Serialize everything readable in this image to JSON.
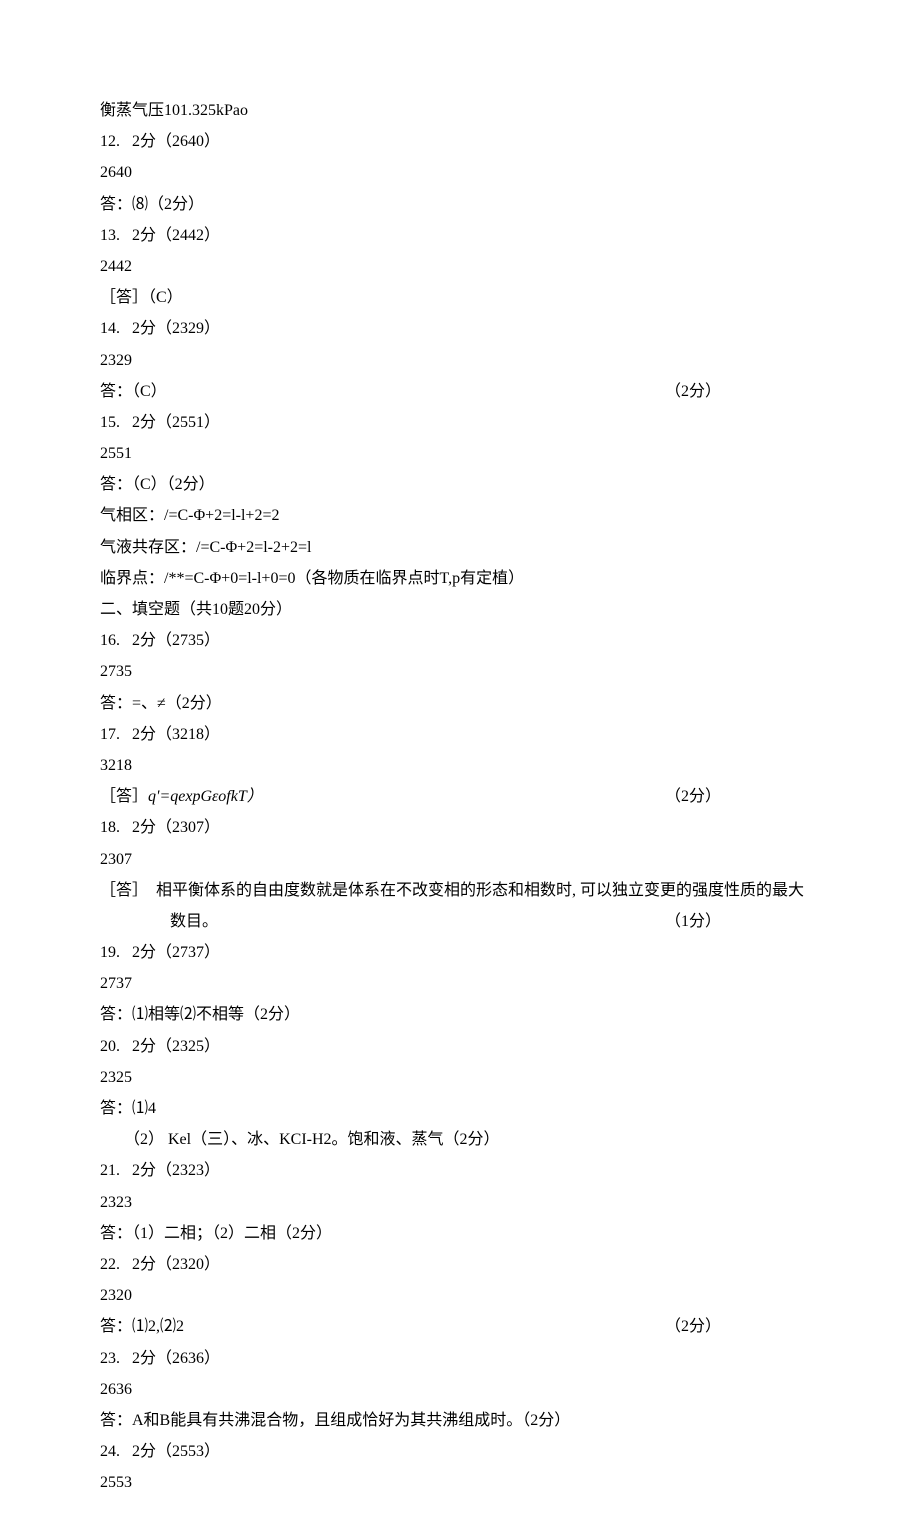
{
  "lines": [
    {
      "text": "衡蒸气压101.325kPao"
    },
    {
      "text": "12.   2分（2640）"
    },
    {
      "text": "2640"
    },
    {
      "text": "答：⑻（2分）"
    },
    {
      "text": "13.   2分（2442）"
    },
    {
      "text": "2442"
    },
    {
      "text": "［答］（C）"
    },
    {
      "text": "14.   2分（2329）"
    },
    {
      "text": "2329"
    },
    {
      "text": "答：（C）",
      "right": "（2分）"
    },
    {
      "text": "15.   2分（2551）"
    },
    {
      "text": "2551"
    },
    {
      "text": "答：（C）（2分）"
    },
    {
      "text": "气相区：/=C-Φ+2=l-l+2=2"
    },
    {
      "text": "气液共存区：/=C-Φ+2=l-2+2=l"
    },
    {
      "text": "临界点：/**=C-Φ+0=l-l+0=0（各物质在临界点时T,p有定植）"
    },
    {
      "text": "二、填空题（共10题20分）"
    },
    {
      "text": "16.   2分（2735）"
    },
    {
      "text": "2735"
    },
    {
      "text": "答：=、≠（2分）"
    },
    {
      "text": "17.   2分（3218）"
    },
    {
      "text": "3218"
    },
    {
      "text": "［答］",
      "italicTail": "q'=qexpGεofkT）",
      "right": "（2分）"
    },
    {
      "text": "18.   2分（2307）"
    },
    {
      "text": "2307"
    },
    {
      "text": "［答］  相平衡体系的自由度数就是体系在不改变相的形态和相数时, 可以独立变更的强度性质的最大"
    },
    {
      "text": "数目。",
      "indent": "big",
      "right": "（1分）"
    },
    {
      "text": "19.   2分（2737）"
    },
    {
      "text": "2737"
    },
    {
      "text": "答：⑴相等⑵不相等（2分）"
    },
    {
      "text": "20.   2分（2325）"
    },
    {
      "text": "2325"
    },
    {
      "text": "答：⑴4"
    },
    {
      "text": "（2） Kel（三）、冰、KCI-H2。饱和液、蒸气（2分）",
      "indent": "small"
    },
    {
      "text": "21.   2分（2323）"
    },
    {
      "text": "2323"
    },
    {
      "text": "答：（1）二相；（2）二相（2分）"
    },
    {
      "text": "22.   2分（2320）"
    },
    {
      "text": "2320"
    },
    {
      "text": "答：⑴2,⑵2",
      "right": "（2分）"
    },
    {
      "text": "23.   2分（2636）"
    },
    {
      "text": "2636"
    },
    {
      "text": "答：A和B能具有共沸混合物，且组成恰好为其共沸组成时。（2分）"
    },
    {
      "text": "24.   2分（2553）"
    },
    {
      "text": "2553"
    }
  ]
}
